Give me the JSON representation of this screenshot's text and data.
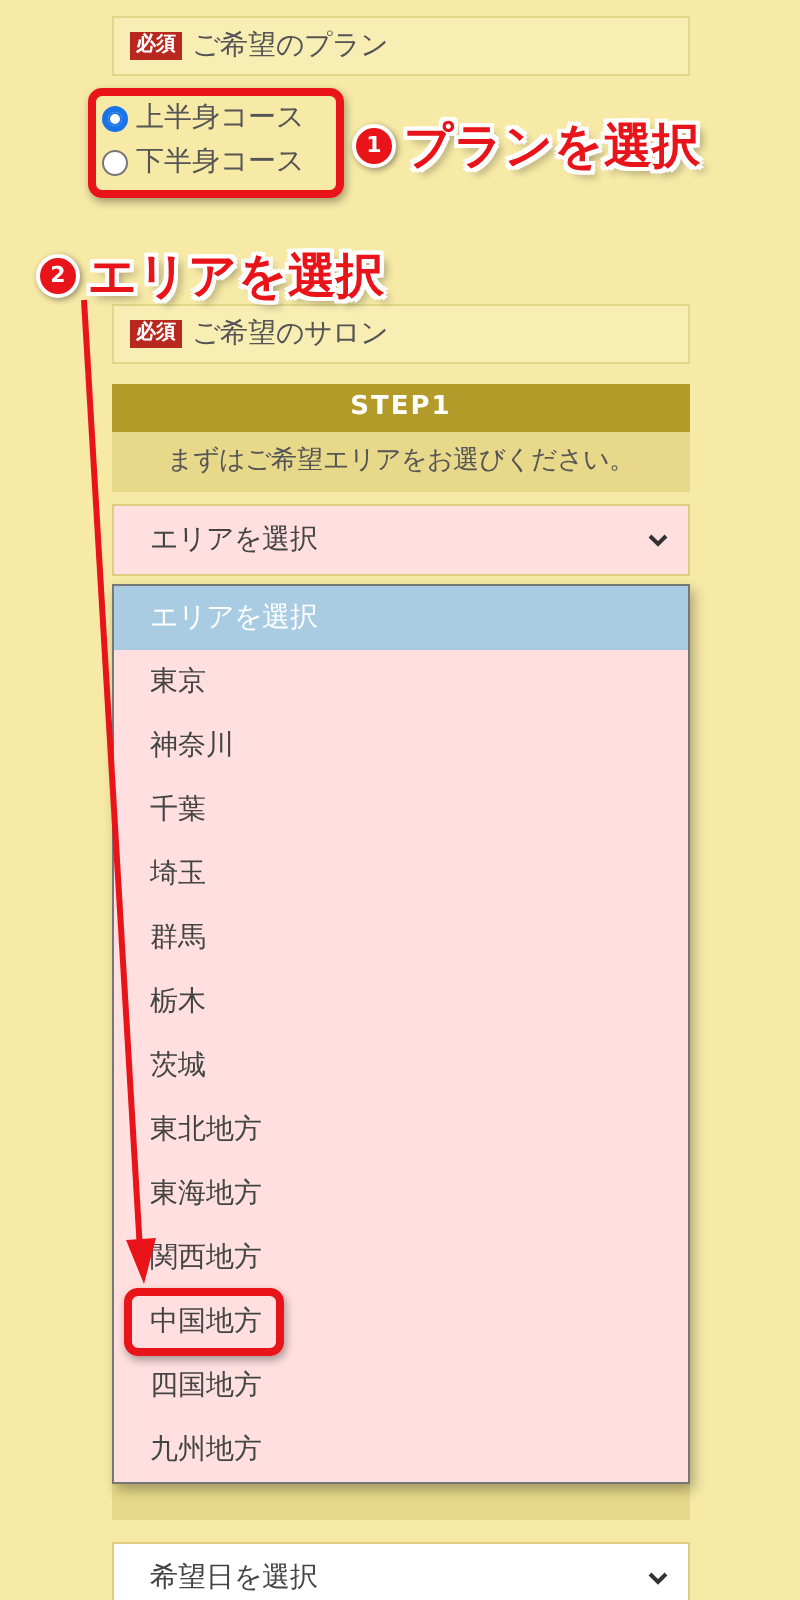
{
  "plan": {
    "required_badge": "必須",
    "label": "ご希望のプラン",
    "options": [
      {
        "label": "上半身コース",
        "selected": true
      },
      {
        "label": "下半身コース",
        "selected": false
      }
    ]
  },
  "salon": {
    "required_badge": "必須",
    "label": "ご希望のサロン",
    "step_title": "STEP1",
    "step_text": "まずはご希望エリアをお選びください。",
    "area_select": {
      "value": "エリアを選択",
      "expanded": true,
      "options": [
        {
          "label": "エリアを選択",
          "selected": true,
          "highlighted": false
        },
        {
          "label": "東京",
          "selected": false,
          "highlighted": false
        },
        {
          "label": "神奈川",
          "selected": false,
          "highlighted": false
        },
        {
          "label": "千葉",
          "selected": false,
          "highlighted": false
        },
        {
          "label": "埼玉",
          "selected": false,
          "highlighted": false
        },
        {
          "label": "群馬",
          "selected": false,
          "highlighted": false
        },
        {
          "label": "栃木",
          "selected": false,
          "highlighted": false
        },
        {
          "label": "茨城",
          "selected": false,
          "highlighted": false
        },
        {
          "label": "東北地方",
          "selected": false,
          "highlighted": false
        },
        {
          "label": "東海地方",
          "selected": false,
          "highlighted": false
        },
        {
          "label": "関西地方",
          "selected": false,
          "highlighted": false
        },
        {
          "label": "中国地方",
          "selected": false,
          "highlighted": true
        },
        {
          "label": "四国地方",
          "selected": false,
          "highlighted": false
        },
        {
          "label": "九州地方",
          "selected": false,
          "highlighted": false
        }
      ]
    }
  },
  "second_choice": {
    "date_select": {
      "value": "希望日を選択"
    }
  },
  "annotations": [
    {
      "number": "1",
      "text": "プランを選択"
    },
    {
      "number": "2",
      "text": "エリアを選択"
    }
  ]
}
